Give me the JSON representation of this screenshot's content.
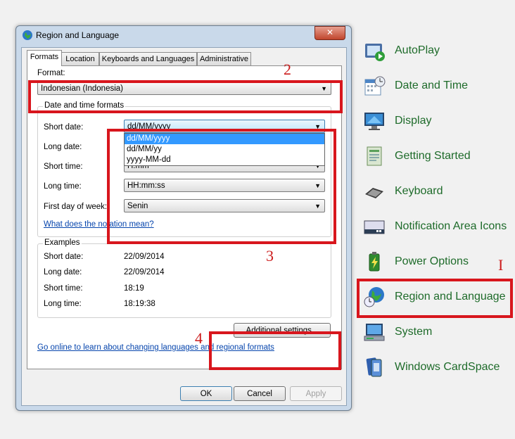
{
  "control_panel": {
    "items": [
      {
        "label": "AutoPlay",
        "icon": "autoplay-icon"
      },
      {
        "label": "Date and Time",
        "icon": "date-time-icon"
      },
      {
        "label": "Display",
        "icon": "display-icon"
      },
      {
        "label": "Getting Started",
        "icon": "getting-started-icon"
      },
      {
        "label": "Keyboard",
        "icon": "keyboard-icon"
      },
      {
        "label": "Notification Area Icons",
        "icon": "notification-area-icon"
      },
      {
        "label": "Power Options",
        "icon": "power-options-icon"
      },
      {
        "label": "Region and Language",
        "icon": "region-language-icon"
      },
      {
        "label": "System",
        "icon": "system-icon"
      },
      {
        "label": "Windows CardSpace",
        "icon": "cardspace-icon"
      }
    ],
    "label_color": "#1e6b2a"
  },
  "dialog": {
    "title": "Region and Language",
    "close_symbol": "✕",
    "tabs": [
      "Formats",
      "Location",
      "Keyboards and Languages",
      "Administrative"
    ],
    "format_label": "Format:",
    "format_value": "Indonesian (Indonesia)",
    "datetime_group_title": "Date and time formats",
    "fields": [
      {
        "label": "Short date:",
        "value": "dd/MM/yyyy"
      },
      {
        "label": "Long date:",
        "value": ""
      },
      {
        "label": "Short time:",
        "value": "H.mm"
      },
      {
        "label": "Long time:",
        "value": "HH:mm:ss"
      },
      {
        "label": "First day of week:",
        "value": "Senin"
      }
    ],
    "short_date_options": [
      "dd/MM/yyyy",
      "dd/MM/yy",
      "yyyy-MM-dd"
    ],
    "notation_link": "What does the notation mean?",
    "examples_group_title": "Examples",
    "examples": [
      {
        "label": "Short date:",
        "value": "22/09/2014"
      },
      {
        "label": "Long date:",
        "value": "22/09/2014"
      },
      {
        "label": "Short time:",
        "value": "18:19"
      },
      {
        "label": "Long time:",
        "value": "18:19:38"
      }
    ],
    "additional_settings": "Additional settings...",
    "online_link": "Go online to learn about changing languages and regional formats",
    "ok": "OK",
    "cancel": "Cancel",
    "apply": "Apply"
  },
  "annotations": {
    "numbers": [
      "I",
      "2",
      "3",
      "4"
    ],
    "color": "#d8161d"
  }
}
